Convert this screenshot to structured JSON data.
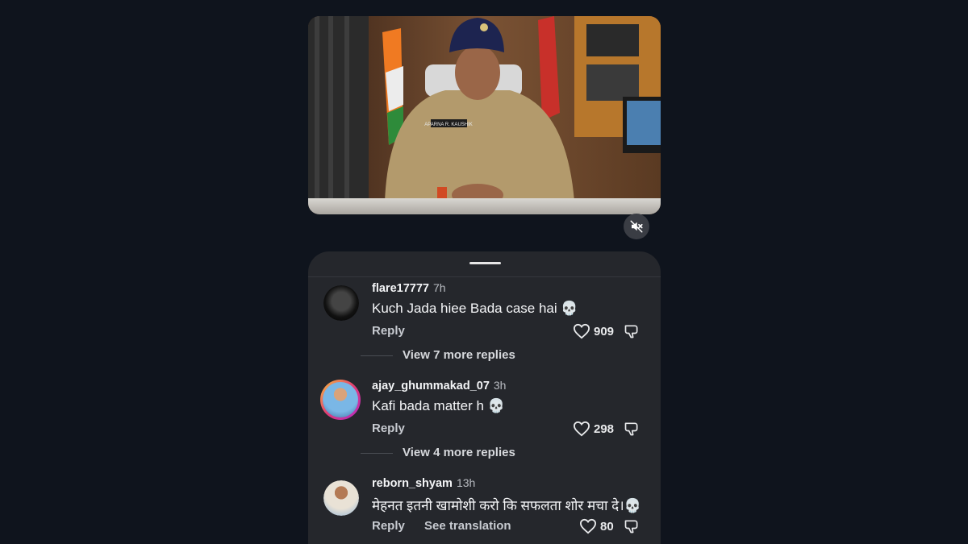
{
  "video": {
    "name_tag": "APARNA R. KAUSHIK",
    "mute_icon": "speaker-muted-icon"
  },
  "sheet": {
    "comments": [
      {
        "username": "flare17777",
        "time": "7h",
        "text": "Kuch Jada hiee Bada case hai 💀",
        "reply_label": "Reply",
        "likes": "909",
        "view_more": "View 7 more replies"
      },
      {
        "username": "ajay_ghummakad_07",
        "time": "3h",
        "text": "Kafi bada matter h 💀",
        "reply_label": "Reply",
        "likes": "298",
        "view_more": "View 4 more replies"
      },
      {
        "username": "reborn_shyam",
        "time": "13h",
        "text": "मेहनत इतनी खामोशी करो कि सफलता शोर मचा दे।💀",
        "reply_label": "Reply",
        "translation_label": "See translation",
        "likes": "80"
      }
    ]
  },
  "colors": {
    "background": "#0f141d",
    "sheet": "#25272c",
    "story_ring": "#e23b73"
  }
}
